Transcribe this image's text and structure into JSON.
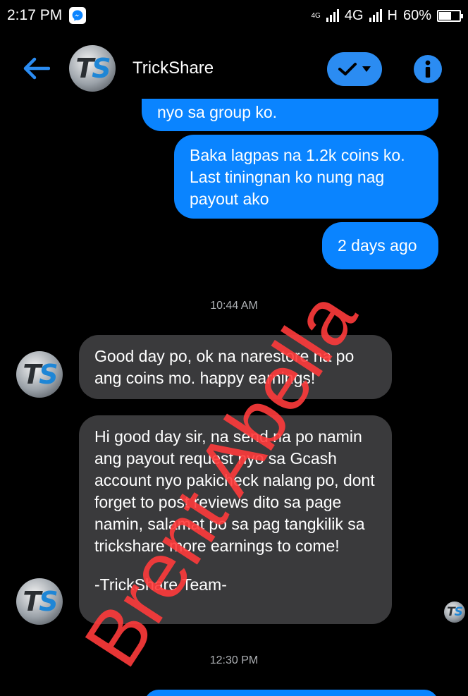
{
  "status_bar": {
    "time": "2:17 PM",
    "net_top": "4G",
    "net_type": "4G",
    "net_type2": "H",
    "battery_percent": "60%",
    "battery_level": 0.6
  },
  "header": {
    "title": "TrickShare",
    "avatar_text": "TS",
    "back_icon": "back-arrow-icon",
    "verify_icon": "checkmark-dropdown-icon",
    "info_icon": "info-icon"
  },
  "messages": {
    "sent1_tail": "nyo sa group ko.",
    "sent2": "Baka lagpas na 1.2k coins ko. Last tiningnan ko nung nag payout ako",
    "sent3": "2 days ago",
    "time1": "10:44 AM",
    "recv1": "Good day po, ok na narestore na po ang coins mo. happy earnings!",
    "recv2": "Hi good day sir, na send na po namin ang payout request nyo sa Gcash account nyo pakicheck nalang po, dont forget to post reviews dito sa page namin, salamat po sa pag tangkilik sa trickshare more earnings to come!",
    "recv2_sign": "-TrickShare Team-",
    "time2": "12:30 PM"
  },
  "watermark": "Brent Abella",
  "colors": {
    "accent": "#0a84ff",
    "received_bubble": "#3a3a3c",
    "background": "#000000",
    "watermark": "#ff3b3b"
  }
}
